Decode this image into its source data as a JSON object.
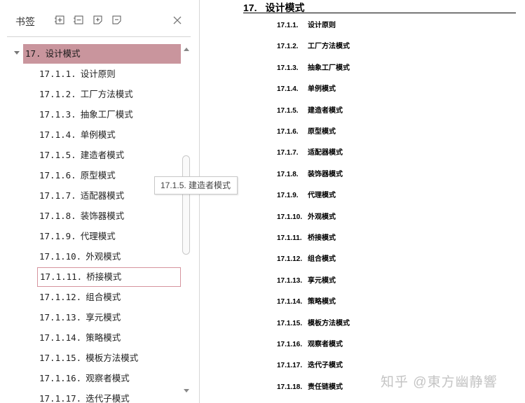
{
  "sidebar": {
    "title": "书签",
    "toolbar": [
      {
        "icon": "expand-all-icon"
      },
      {
        "icon": "collapse-all-icon"
      },
      {
        "icon": "add-bookmark-icon"
      },
      {
        "icon": "delete-bookmark-icon"
      }
    ],
    "close_icon": "close-icon",
    "parent": {
      "num": "17.",
      "label": "设计模式"
    },
    "items": [
      {
        "num": "17.1.1.",
        "label": "设计原则"
      },
      {
        "num": "17.1.2.",
        "label": "工厂方法模式"
      },
      {
        "num": "17.1.3.",
        "label": "抽象工厂模式"
      },
      {
        "num": "17.1.4.",
        "label": "单例模式"
      },
      {
        "num": "17.1.5.",
        "label": "建造者模式"
      },
      {
        "num": "17.1.6.",
        "label": "原型模式"
      },
      {
        "num": "17.1.7.",
        "label": "适配器模式"
      },
      {
        "num": "17.1.8.",
        "label": "装饰器模式"
      },
      {
        "num": "17.1.9.",
        "label": "代理模式"
      },
      {
        "num": "17.1.10.",
        "label": "外观模式"
      },
      {
        "num": "17.1.11.",
        "label": "桥接模式"
      },
      {
        "num": "17.1.12.",
        "label": "组合模式"
      },
      {
        "num": "17.1.13.",
        "label": "享元模式"
      },
      {
        "num": "17.1.14.",
        "label": "策略模式"
      },
      {
        "num": "17.1.15.",
        "label": "模板方法模式"
      },
      {
        "num": "17.1.16.",
        "label": "观察者模式"
      },
      {
        "num": "17.1.17.",
        "label": "迭代子模式"
      }
    ],
    "tooltip": "17.1.5. 建造者模式"
  },
  "document": {
    "heading": {
      "num": "17.",
      "title": "设计模式"
    },
    "items": [
      {
        "num": "17.1.1.",
        "title": "设计原则"
      },
      {
        "num": "17.1.2.",
        "title": "工厂方法模式"
      },
      {
        "num": "17.1.3.",
        "title": "抽象工厂模式"
      },
      {
        "num": "17.1.4.",
        "title": "单例模式"
      },
      {
        "num": "17.1.5.",
        "title": "建造者模式"
      },
      {
        "num": "17.1.6.",
        "title": "原型模式"
      },
      {
        "num": "17.1.7.",
        "title": "适配器模式"
      },
      {
        "num": "17.1.8.",
        "title": "装饰器模式"
      },
      {
        "num": "17.1.9.",
        "title": "代理模式"
      },
      {
        "num": "17.1.10.",
        "title": "外观模式"
      },
      {
        "num": "17.1.11.",
        "title": "桥接模式"
      },
      {
        "num": "17.1.12.",
        "title": "组合模式"
      },
      {
        "num": "17.1.13.",
        "title": "享元模式"
      },
      {
        "num": "17.1.14.",
        "title": "策略模式"
      },
      {
        "num": "17.1.15.",
        "title": "模板方法模式"
      },
      {
        "num": "17.1.16.",
        "title": "观察者模式"
      },
      {
        "num": "17.1.17.",
        "title": "迭代子模式"
      },
      {
        "num": "17.1.18.",
        "title": "责任链模式"
      }
    ]
  },
  "watermark": "知乎 @東方幽静響",
  "colors": {
    "selected_bg": "#c9959d",
    "focus_border": "#d5939e"
  }
}
